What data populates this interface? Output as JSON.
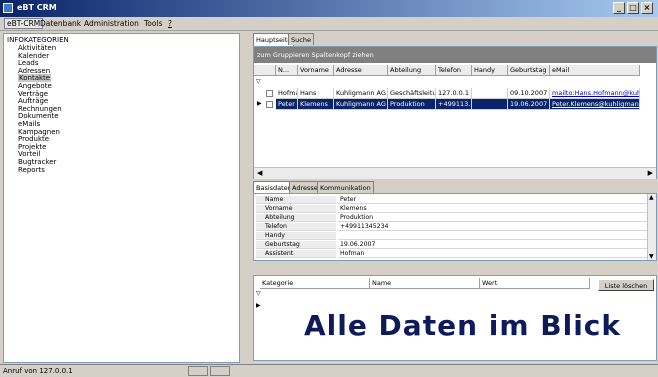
{
  "window": {
    "title": "eBT CRM"
  },
  "menu": {
    "items": [
      "eBT-CRM",
      "Datenbank",
      "Administration",
      "Tools",
      "?"
    ]
  },
  "tree": {
    "root": "INFOKATEGORIEN",
    "items": [
      "Aktivitäten",
      "Kalender",
      "Leads",
      "Adressen",
      "Kontakte",
      "Angebote",
      "Verträge",
      "Aufträge",
      "Rechnungen",
      "Dokumente",
      "eMails",
      "Kampagnen",
      "Produkte",
      "Projekte",
      "Vorteil",
      "Bugtracker",
      "Reports"
    ],
    "selected": "Kontakte"
  },
  "tabs_main": [
    "Hauptseite",
    "Suche"
  ],
  "grid": {
    "group_hint": "zum Gruppieren Spaltenkopf ziehen",
    "columns": [
      "N...",
      "Vorname",
      "Adresse",
      "Abteilung",
      "Telefon",
      "Handy",
      "Geburtstag",
      "eMail"
    ],
    "rows": [
      {
        "name": "Hofman",
        "vorname": "Hans",
        "adresse": "Kuhligmann AG",
        "abteilung": "Geschäftsleitung",
        "telefon": "127.0.0.1",
        "handy": "",
        "geburtstag": "09.10.2007",
        "email": "mailto:Hans.Hofmann@kuhligm"
      },
      {
        "name": "Peter",
        "vorname": "Klemens",
        "adresse": "Kuhligmann AG",
        "abteilung": "Produktion",
        "telefon": "+499113...",
        "handy": "",
        "geburtstag": "19.06.2007",
        "email": "Peter.Klemens@kuhligmann-ag.d"
      }
    ]
  },
  "tabs_detail": [
    "Basisdaten",
    "Adresse",
    "Kommunikation"
  ],
  "detail": [
    {
      "label": "Name",
      "value": "Peter"
    },
    {
      "label": "Vorname",
      "value": "Klemens"
    },
    {
      "label": "Abteilung",
      "value": "Produktion"
    },
    {
      "label": "Telefon",
      "value": "+49911345234"
    },
    {
      "label": "Handy",
      "value": ""
    },
    {
      "label": "Geburtstag",
      "value": "19.06.2007"
    },
    {
      "label": "Assistent",
      "value": "Hofman"
    }
  ],
  "lower": {
    "columns": [
      "Kategorie",
      "Name",
      "Wert"
    ],
    "button": "Liste löschen"
  },
  "overlay": {
    "text": "Alle Daten im Blick"
  },
  "status": {
    "text": "Anruf von 127.0.0.1"
  }
}
